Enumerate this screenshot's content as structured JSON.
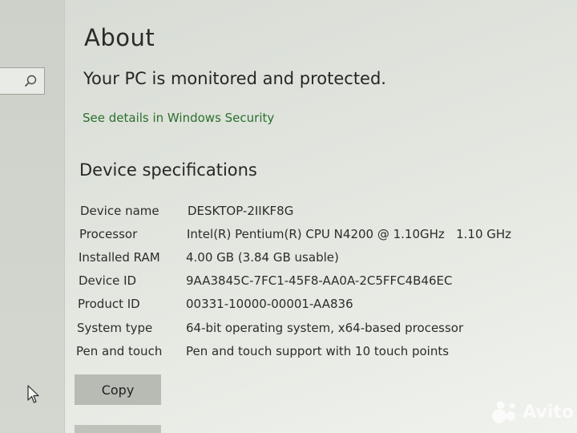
{
  "page": {
    "title": "About",
    "protection_status": "Your PC is monitored and protected.",
    "security_link": "See details in Windows Security"
  },
  "sidebar": {
    "search_icon": "search-icon"
  },
  "specs": {
    "heading": "Device specifications",
    "rows": [
      {
        "label": "Device name",
        "value": "DESKTOP-2IIKF8G"
      },
      {
        "label": "Processor",
        "value": "Intel(R) Pentium(R) CPU N4200 @ 1.10GHz   1.10 GHz"
      },
      {
        "label": "Installed RAM",
        "value": "4.00 GB (3.84 GB usable)"
      },
      {
        "label": "Device ID",
        "value": "9AA3845C-7FC1-45F8-AA0A-2C5FFC4B46EC"
      },
      {
        "label": "Product ID",
        "value": "00331-10000-00001-AA836"
      },
      {
        "label": "System type",
        "value": "64-bit operating system, x64-based processor"
      },
      {
        "label": "Pen and touch",
        "value": "Pen and touch support with 10 touch points"
      }
    ]
  },
  "actions": {
    "copy_label": "Copy"
  },
  "watermark": {
    "text": "Avito"
  },
  "colors": {
    "link": "#2b6f2d",
    "text": "#2c2d2a",
    "button": "#b8bbb4"
  }
}
